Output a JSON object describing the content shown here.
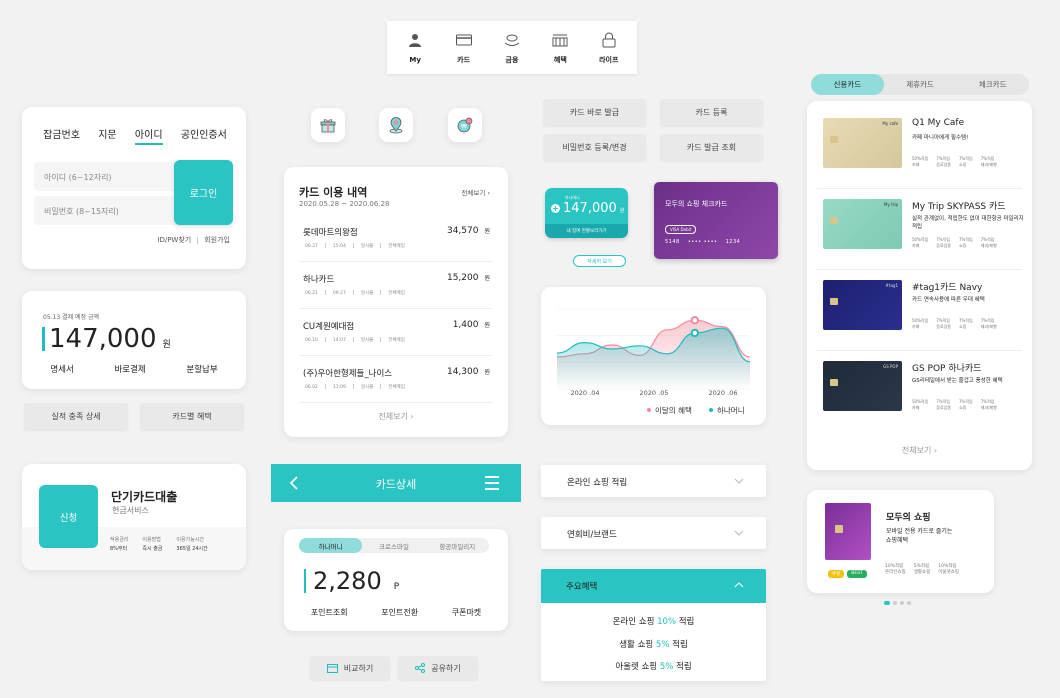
{
  "topnav": {
    "items": [
      {
        "label": "My",
        "icon": "person-icon"
      },
      {
        "label": "카드",
        "icon": "card-icon"
      },
      {
        "label": "금융",
        "icon": "finance-icon"
      },
      {
        "label": "혜택",
        "icon": "benefit-icon"
      },
      {
        "label": "라이프",
        "icon": "lock-icon"
      }
    ]
  },
  "login": {
    "tabs": [
      "잡금번호",
      "지문",
      "아이디",
      "공인인증서"
    ],
    "active_tab": 2,
    "id_placeholder": "아이디 (6~12자리)",
    "pw_placeholder": "비밀번호 (8~15자리)",
    "login_label": "로그인",
    "find_label": "ID/PW찾기",
    "join_label": "회원가입"
  },
  "payment": {
    "subtitle": "05.13 결제 예정 금액",
    "amount": "147,000",
    "unit": "원",
    "actions": [
      "명세서",
      "바로결제",
      "분할납부"
    ]
  },
  "perf_buttons": [
    "실적 충족 상세",
    "카드별 혜택"
  ],
  "loan": {
    "badge": "신청",
    "title": "단기카드대출",
    "subtitle": "현금서비스",
    "cols": [
      {
        "label": "적용금리",
        "value": "8%부터"
      },
      {
        "label": "이용방법",
        "value": "즉시 출금"
      },
      {
        "label": "이용가능시간",
        "value": "365일 24시간"
      }
    ]
  },
  "usage": {
    "title": "카드 이용 내역",
    "range": "2020.05.28 ~ 2020.06.28",
    "viewall": "전체보기",
    "more": "전체보기",
    "rows": [
      {
        "name": "롯데마트의왕점",
        "amount": "34,570",
        "unit": "원",
        "d1": "06.27",
        "d2": "15:04",
        "d3": "일시불",
        "d4": "전체매입"
      },
      {
        "name": "하나카드",
        "amount": "15,200",
        "unit": "원",
        "d1": "06.21",
        "d2": "09:27",
        "d3": "일시불",
        "d4": "전체매입"
      },
      {
        "name": "CU계원예대점",
        "amount": "1,400",
        "unit": "원",
        "d1": "06.10",
        "d2": "14:07",
        "d3": "일시불",
        "d4": "전체매입"
      },
      {
        "name": "(주)우아한형제들_나이스",
        "amount": "14,300",
        "unit": "원",
        "d1": "06.02",
        "d2": "11:09",
        "d3": "일시불",
        "d4": "전체매입"
      }
    ]
  },
  "carddetail": {
    "title": "카드상세"
  },
  "points": {
    "tabs": [
      "하나머니",
      "크로스마일",
      "항공마일리지"
    ],
    "value": "2,280",
    "unit": "P",
    "actions": [
      "포인트조회",
      "포인트전환",
      "쿠폰마켓"
    ]
  },
  "share": {
    "compare": "비교하기",
    "share": "공유하기"
  },
  "cardmenu": [
    "카드 바로 발급",
    "카드 등록",
    "비밀번호 등록/변경",
    "카드 발급 조회"
  ],
  "mini": {
    "small": "하나머니",
    "amount": "147,000",
    "unit": "원",
    "sub": "내 참여 현황보러가기",
    "pill": "자세히 보기"
  },
  "purple": {
    "title": "모두의 쇼핑 체크카드",
    "tag": "VISA Debit",
    "num1": "5148",
    "num2": "1234"
  },
  "chart_data": {
    "type": "area",
    "categories": [
      "2020 .04",
      "2020 .05",
      "2020 .06"
    ],
    "series": [
      {
        "name": "이달의 혜택",
        "color": "#f48a9c",
        "values": [
          40,
          44,
          55,
          42,
          74,
          86,
          78,
          40
        ]
      },
      {
        "name": "하나머니",
        "color": "#1fbcc0",
        "values": [
          45,
          58,
          50,
          54,
          44,
          70,
          76,
          34
        ]
      }
    ],
    "grid": true,
    "legend": "bottom-right"
  },
  "accordion": {
    "items": [
      "온라인 쇼핑 적립",
      "연회비/브랜드"
    ],
    "open_title": "주요혜택",
    "open_lines": [
      {
        "pre": "온라인 쇼핑 ",
        "hl": "10%",
        "post": " 적립"
      },
      {
        "pre": "생활 쇼핑 ",
        "hl": "5%",
        "post": " 적립"
      },
      {
        "pre": "아울렛 쇼핑 ",
        "hl": "5%",
        "post": " 적립"
      }
    ]
  },
  "cardlist": {
    "tabs": [
      "신용카드",
      "제휴카드",
      "체크카드"
    ],
    "more": "전체보기",
    "cards": [
      {
        "name": "Q1 My Cafe",
        "desc": "카페 마니아에게 필수템!",
        "cardText": "My cafe",
        "stats": [
          [
            "50%적립",
            "카페"
          ],
          [
            "7%적립",
            "음료업종"
          ],
          [
            "7%적립",
            "쇼핑"
          ],
          [
            "7%적립",
            "제과/제빵"
          ]
        ]
      },
      {
        "name": "My Trip SKYPASS 카드",
        "desc": "실적 관계없이, 적립한도 없이 대한항공 마일리지 적립",
        "cardText": "My trip",
        "stats": [
          [
            "50%적립",
            "카페"
          ],
          [
            "7%적립",
            "음료업종"
          ],
          [
            "7%적립",
            "쇼핑"
          ],
          [
            "7%적립",
            "제과/제빵"
          ]
        ]
      },
      {
        "name": "#tag1카드 Navy",
        "desc": "카드 연속사용에 따른 우대 혜택",
        "cardText": "#tag1",
        "stats": [
          [
            "50%적립",
            "카페"
          ],
          [
            "7%적립",
            "음료업종"
          ],
          [
            "7%적립",
            "쇼핑"
          ],
          [
            "7%적립",
            "제과/제빵"
          ]
        ]
      },
      {
        "name": "GS POP 하나카드",
        "desc": "GS리테일에서 받는 즐겁고 풍성한 혜택",
        "cardText": "GS POP",
        "stats": [
          [
            "50%적립",
            "카페"
          ],
          [
            "7%적립",
            "음료업종"
          ],
          [
            "7%적립",
            "쇼핑"
          ],
          [
            "7%적립",
            "제과/제빵"
          ]
        ]
      }
    ]
  },
  "shop": {
    "title": "모두의 쇼핑",
    "desc": "모바일 전용 카드로 즐기는 쇼핑혜택",
    "tags": [
      "추천",
      "BEST"
    ],
    "stats": [
      [
        "10%적립",
        "온라인쇼핑"
      ],
      [
        "5%적립",
        "생활쇼핑"
      ],
      [
        "10%적립",
        "아울렛쇼핑"
      ]
    ]
  }
}
